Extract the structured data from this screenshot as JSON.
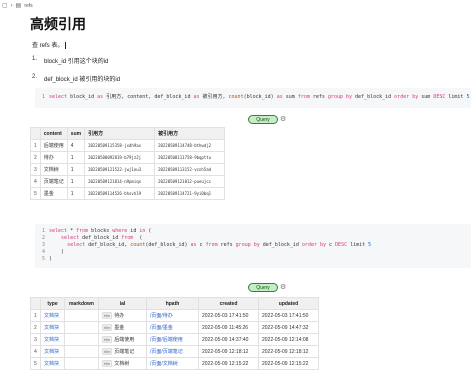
{
  "breadcrumb": {
    "doc_label": "refs"
  },
  "page_title": "高频引用",
  "intro": "查 refs 表。",
  "defs": [
    {
      "num": "1.",
      "text": "block_id 引用这个块的id"
    },
    {
      "num": "2.",
      "text": "def_block_id 被引用的块的id"
    }
  ],
  "query_button": "Query",
  "table1": {
    "headers": [
      "",
      "content",
      "sum",
      "引用方",
      "被引用方"
    ],
    "rows": [
      {
        "n": "1",
        "content": "后端使用",
        "sum": "4",
        "a": "20220509115358-jxdh9ax",
        "b": "20220509114748-bthwdj2"
      },
      {
        "n": "2",
        "content": "待办",
        "sum": "1",
        "a": "20220508092819-b79jz2j",
        "b": "20220508111758-9bqpttu"
      },
      {
        "n": "3",
        "content": "文档树",
        "sum": "1",
        "a": "20220509121522-jwj1ou3",
        "b": "20220509113152-vcnh5ad"
      },
      {
        "n": "4",
        "content": "页端笔记",
        "sum": "1",
        "a": "20220509121814-n9pmiqx",
        "b": "20220509121812-pueujcc"
      },
      {
        "n": "5",
        "content": "墨金",
        "sum": "1",
        "a": "20220509114526-bhsvh19",
        "b": "20220509114721-9yi0bq1"
      }
    ]
  },
  "table2": {
    "headers": [
      "",
      "type",
      "markdown",
      "ial",
      "hpath",
      "created",
      "updated"
    ],
    "rows": [
      {
        "n": "1",
        "type": "文档块",
        "tag": "title",
        "ial": "待办",
        "hpath": "/页面/待办",
        "created": "2022-05-03 17:41:50",
        "updated": "2022-05-03 17:41:50"
      },
      {
        "n": "2",
        "type": "文档块",
        "tag": "title",
        "ial": "墨金",
        "hpath": "/页面/墨金",
        "created": "2022-05-09 11:45:26",
        "updated": "2022-05-09 14:47:32"
      },
      {
        "n": "3",
        "type": "文档块",
        "tag": "title",
        "ial": "后端使用",
        "hpath": "/页面/后端使用",
        "created": "2022-05-09 14:37:40",
        "updated": "2022-05-09 12:14:08"
      },
      {
        "n": "4",
        "type": "文档块",
        "tag": "title",
        "ial": "页端笔记",
        "hpath": "/页面/页端笔记",
        "created": "2022-05-09 12:18:12",
        "updated": "2022-05-09 12:18:12"
      },
      {
        "n": "5",
        "type": "文档块",
        "tag": "title",
        "ial": "文档树",
        "hpath": "/页面/文档树",
        "created": "2022-05-09 12:15:22",
        "updated": "2022-05-09 12:15:22"
      }
    ]
  }
}
